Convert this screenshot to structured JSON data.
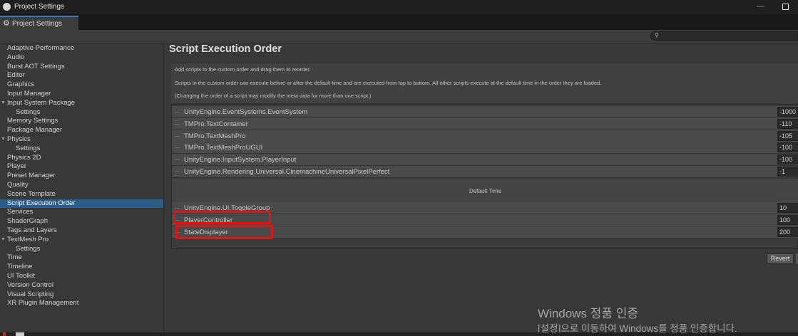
{
  "window": {
    "title": "Project Settings"
  },
  "tab": {
    "label": "Project Settings",
    "icon": "gear-icon"
  },
  "search": {
    "icon": "search-icon",
    "value": ""
  },
  "sidebar": {
    "items": [
      {
        "label": "Adaptive Performance",
        "level": 0,
        "expandable": false,
        "selected": false
      },
      {
        "label": "Audio",
        "level": 0,
        "expandable": false,
        "selected": false
      },
      {
        "label": "Burst AOT Settings",
        "level": 0,
        "expandable": false,
        "selected": false
      },
      {
        "label": "Editor",
        "level": 0,
        "expandable": false,
        "selected": false
      },
      {
        "label": "Graphics",
        "level": 0,
        "expandable": false,
        "selected": false
      },
      {
        "label": "Input Manager",
        "level": 0,
        "expandable": false,
        "selected": false
      },
      {
        "label": "Input System Package",
        "level": 0,
        "expandable": true,
        "selected": false
      },
      {
        "label": "Settings",
        "level": 1,
        "expandable": false,
        "selected": false
      },
      {
        "label": "Memory Settings",
        "level": 0,
        "expandable": false,
        "selected": false
      },
      {
        "label": "Package Manager",
        "level": 0,
        "expandable": false,
        "selected": false
      },
      {
        "label": "Physics",
        "level": 0,
        "expandable": true,
        "selected": false
      },
      {
        "label": "Settings",
        "level": 1,
        "expandable": false,
        "selected": false
      },
      {
        "label": "Physics 2D",
        "level": 0,
        "expandable": false,
        "selected": false
      },
      {
        "label": "Player",
        "level": 0,
        "expandable": false,
        "selected": false
      },
      {
        "label": "Preset Manager",
        "level": 0,
        "expandable": false,
        "selected": false
      },
      {
        "label": "Quality",
        "level": 0,
        "expandable": false,
        "selected": false
      },
      {
        "label": "Scene Template",
        "level": 0,
        "expandable": false,
        "selected": false
      },
      {
        "label": "Script Execution Order",
        "level": 0,
        "expandable": false,
        "selected": true
      },
      {
        "label": "Services",
        "level": 0,
        "expandable": false,
        "selected": false
      },
      {
        "label": "ShaderGraph",
        "level": 0,
        "expandable": false,
        "selected": false
      },
      {
        "label": "Tags and Layers",
        "level": 0,
        "expandable": false,
        "selected": false
      },
      {
        "label": "TextMesh Pro",
        "level": 0,
        "expandable": true,
        "selected": false
      },
      {
        "label": "Settings",
        "level": 1,
        "expandable": false,
        "selected": false
      },
      {
        "label": "Time",
        "level": 0,
        "expandable": false,
        "selected": false
      },
      {
        "label": "Timeline",
        "level": 0,
        "expandable": false,
        "selected": false
      },
      {
        "label": "UI Toolkit",
        "level": 0,
        "expandable": false,
        "selected": false
      },
      {
        "label": "Version Control",
        "level": 0,
        "expandable": false,
        "selected": false
      },
      {
        "label": "Visual Scripting",
        "level": 0,
        "expandable": false,
        "selected": false
      },
      {
        "label": "XR Plugin Management",
        "level": 0,
        "expandable": false,
        "selected": false
      }
    ]
  },
  "main": {
    "title": "Script Execution Order",
    "description": [
      "Add scripts to the custom order and drag them to reorder.",
      "Scripts in the custom order can execute before or after the default time and are executed from top to bottom. All other scripts execute at the default time in the order they are loaded.",
      "(Changing the order of a script may modify the meta data for more than one script.)"
    ],
    "before_default": [
      {
        "name": "UnityEngine.EventSystems.EventSystem",
        "value": "-1000"
      },
      {
        "name": "TMPro.TextContainer",
        "value": "-110"
      },
      {
        "name": "TMPro.TextMeshPro",
        "value": "-105"
      },
      {
        "name": "TMPro.TextMeshProUGUI",
        "value": "-100"
      },
      {
        "name": "UnityEngine.InputSystem.PlayerInput",
        "value": "-100"
      },
      {
        "name": "UnityEngine.Rendering.Universal.CinemachineUniversalPixelPerfect",
        "value": "-1"
      }
    ],
    "default_time_label": "Default Time",
    "after_default": [
      {
        "name": "UnityEngine.UI.ToggleGroup",
        "value": "10"
      },
      {
        "name": "PlayerController",
        "value": "100"
      },
      {
        "name": "StateDisplayer",
        "value": "200"
      }
    ],
    "revert_label": "Revert"
  },
  "watermark": {
    "line1": "Windows 정품 인증",
    "line2": "[설정]으로 이동하여 Windows를 정품 인증합니다."
  },
  "colors": {
    "selection": "#2c5d87",
    "tab_accent": "#3a79bb",
    "highlight": "#e01515"
  }
}
